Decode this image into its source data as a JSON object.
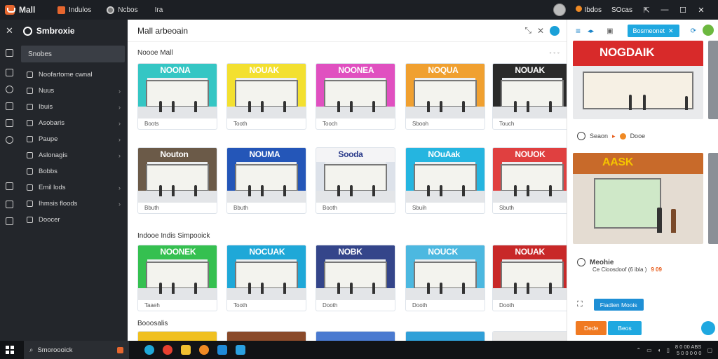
{
  "app": {
    "title": "Mall",
    "tabs": [
      {
        "label": "Indulos",
        "icon": "grid-icon",
        "color": "#e6662e"
      },
      {
        "label": "Ncbos",
        "icon": "circle-icon",
        "color": "#cccccc"
      },
      {
        "label": "Ira",
        "icon": "",
        "color": ""
      }
    ],
    "user": {
      "label": "Ibdos",
      "status_label": "SOcas"
    }
  },
  "sidebar": {
    "title": "Smbroxie",
    "search_label": "Snobes",
    "items": [
      {
        "label": "Noofartome cwnal",
        "icon": "store-icon",
        "has_chevron": false
      },
      {
        "label": "Nuus",
        "icon": "circle-icon",
        "has_chevron": true
      },
      {
        "label": "Ibuis",
        "icon": "box-icon",
        "has_chevron": true
      },
      {
        "label": "Asobaris",
        "icon": "tag-icon",
        "has_chevron": true
      },
      {
        "label": "Paupe",
        "icon": "user-icon",
        "has_chevron": true
      },
      {
        "label": "Aslonagis",
        "icon": "chat-icon",
        "has_chevron": true
      },
      {
        "label": "Bobbs",
        "icon": "folder-icon",
        "has_chevron": false
      },
      {
        "label": "Emil lods",
        "icon": "mail-icon",
        "has_chevron": true
      },
      {
        "label": "Ihmsis floods",
        "icon": "list-icon",
        "has_chevron": true
      },
      {
        "label": "Doocer",
        "icon": "gear-icon",
        "has_chevron": false
      }
    ]
  },
  "main": {
    "title": "Mall arbeoain",
    "section1_title": "Noooe Mall",
    "section2_title": "Indooe Indis Simpooick",
    "section3_title": "Booosalis",
    "row1": [
      {
        "sign": "NOONA",
        "caption": "Boots",
        "sign_color": "#cc2a3c",
        "wall": "#35c6c4"
      },
      {
        "sign": "NOUAK",
        "caption": "Tooth",
        "sign_color": "#e8c800",
        "wall": "#f3e030"
      },
      {
        "sign": "NOONEA",
        "caption": "Tooch",
        "sign_color": "#d63fb5",
        "wall": "#e050c0"
      },
      {
        "sign": "NOQUA",
        "caption": "Sbooh",
        "sign_color": "#e87a1e",
        "wall": "#f0a030"
      },
      {
        "sign": "NOUAK",
        "caption": "Touch",
        "sign_color": "#d32020",
        "wall": "#2a2a2a"
      }
    ],
    "row2": [
      {
        "sign": "Nouton",
        "caption": "Bbuth",
        "sign_color": "#5a4a3a",
        "wall": "#6b5a48"
      },
      {
        "sign": "NOUMA",
        "caption": "Bbuth",
        "sign_color": "#e03030",
        "wall": "#2456b8"
      },
      {
        "sign": "Sooda",
        "caption": "Booth",
        "sign_color": "#ffffff",
        "wall": "#dde2ea"
      },
      {
        "sign": "NOuAak",
        "caption": "Sbuih",
        "sign_color": "#1fa8d8",
        "wall": "#25b5e0"
      },
      {
        "sign": "NOUOK",
        "caption": "Sbuth",
        "sign_color": "#d62828",
        "wall": "#e04040"
      }
    ],
    "row3": [
      {
        "sign": "NOONEK",
        "caption": "Taaeh",
        "sign_color": "#2db84a",
        "wall": "#35c050"
      },
      {
        "sign": "NOCUAK",
        "caption": "Tooth",
        "sign_color": "#d63fb5",
        "wall": "#1fa8d8"
      },
      {
        "sign": "NOBK",
        "caption": "Dooth",
        "sign_color": "#2b3a7a",
        "wall": "#34458a"
      },
      {
        "sign": "NOUCK",
        "caption": "Dooth",
        "sign_color": "#1fa8d8",
        "wall": "#4cb8e0"
      },
      {
        "sign": "NOUAK",
        "caption": "Dooth",
        "sign_color": "#d32020",
        "wall": "#c82828"
      }
    ],
    "row4_walls": [
      "#f0c020",
      "#8a4a2a",
      "#4a7ad0",
      "#30a0d8",
      "#e8e8e8"
    ]
  },
  "right_panel": {
    "header_button": "Bosmeonet",
    "image1_sign": "NOGDAIK",
    "image2_sign": "AASK",
    "meta_label": "Seaon",
    "meta_value": "Dooe",
    "product_title": "Meohie",
    "product_sub": "Ce Cioosdoof (6 ibla )",
    "price": "9 09",
    "action_primary": "Fiadien Moois",
    "btn_orange": "Dede",
    "btn_blue": "Beos"
  },
  "taskbar": {
    "search_label": "Smoroooick",
    "time": "8 0 00 ABS",
    "date": "5 0 0 0 0 0",
    "apps": [
      {
        "icon": "cortana-icon",
        "color": "#1fa8d8"
      },
      {
        "icon": "chrome-icon",
        "color": "#e84030"
      },
      {
        "icon": "folder-icon",
        "color": "#f0c030"
      },
      {
        "icon": "firefox-icon",
        "color": "#f08a24"
      },
      {
        "icon": "edge-icon",
        "color": "#1f8ad8"
      },
      {
        "icon": "store-icon",
        "color": "#2aa0e0"
      }
    ]
  }
}
